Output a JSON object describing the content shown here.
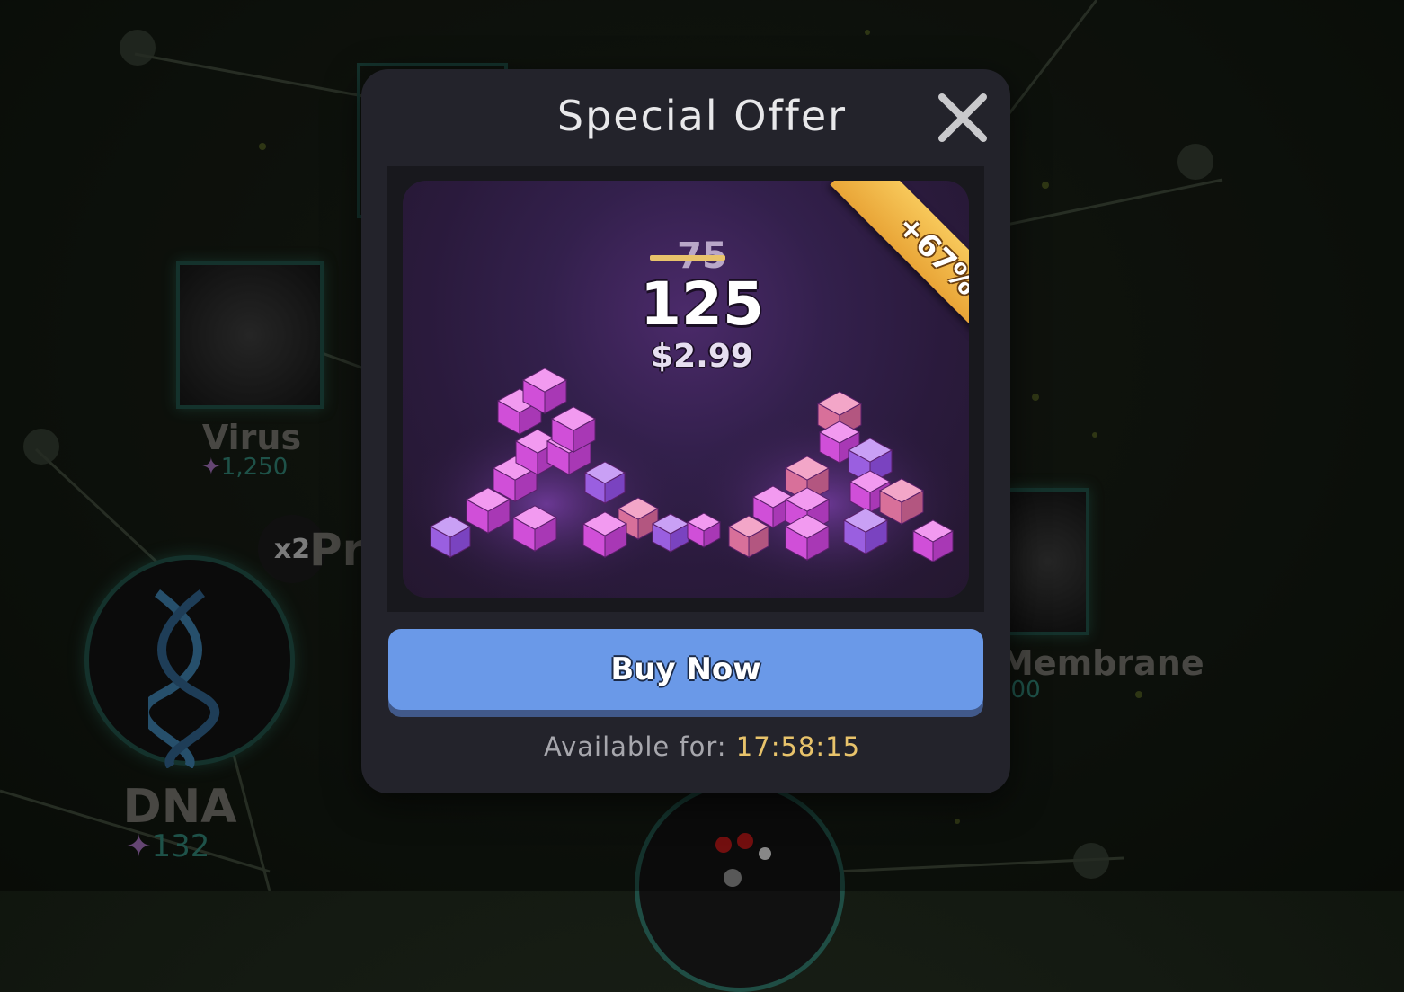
{
  "background": {
    "nodes": [
      {
        "name": "Virus",
        "cost": "1,250"
      },
      {
        "name": "Membrane",
        "cost": "300"
      },
      {
        "name": "DNA",
        "cost": "132"
      }
    ],
    "multiplier": "x2",
    "partial_label": "Pr"
  },
  "modal": {
    "title": "Special Offer",
    "close_icon": "close-icon",
    "offer": {
      "old_amount": "75",
      "new_amount": "125",
      "price": "$2.99",
      "bonus_badge": "+67%",
      "item_icon": "purple-cubes"
    },
    "buy_button": "Buy Now",
    "available_label": "Available for:",
    "available_time": "17:58:15"
  },
  "colors": {
    "accent_button": "#6a99e8",
    "timer": "#e8c36b",
    "badge": "#f0b445"
  }
}
